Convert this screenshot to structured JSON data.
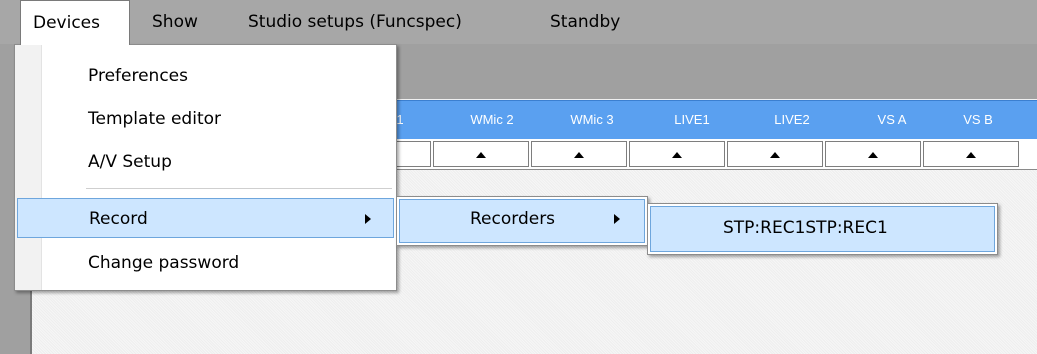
{
  "menubar": {
    "items": [
      "Devices",
      "Show",
      "Studio setups (Funcspec)",
      "Standby"
    ]
  },
  "devices_menu": {
    "items": [
      "Preferences",
      "Template editor",
      "A/V Setup",
      "Record",
      "Change password"
    ]
  },
  "record_submenu": {
    "item": "Recorders"
  },
  "recorders_submenu": {
    "item": "STP:REC1STP:REC1"
  },
  "channel_strip": {
    "partial_label": "1",
    "labels": [
      "WMic 2",
      "WMic 3",
      "LIVE1",
      "LIVE2",
      "VS A",
      "VS B"
    ],
    "header_color": "#5aa0f0",
    "fader_icon": "triangle-up-icon"
  },
  "colors": {
    "menu_highlight": "#cde6ff",
    "menu_highlight_border": "#6ea6dd",
    "menubar_bg": "#a7a7a7"
  }
}
